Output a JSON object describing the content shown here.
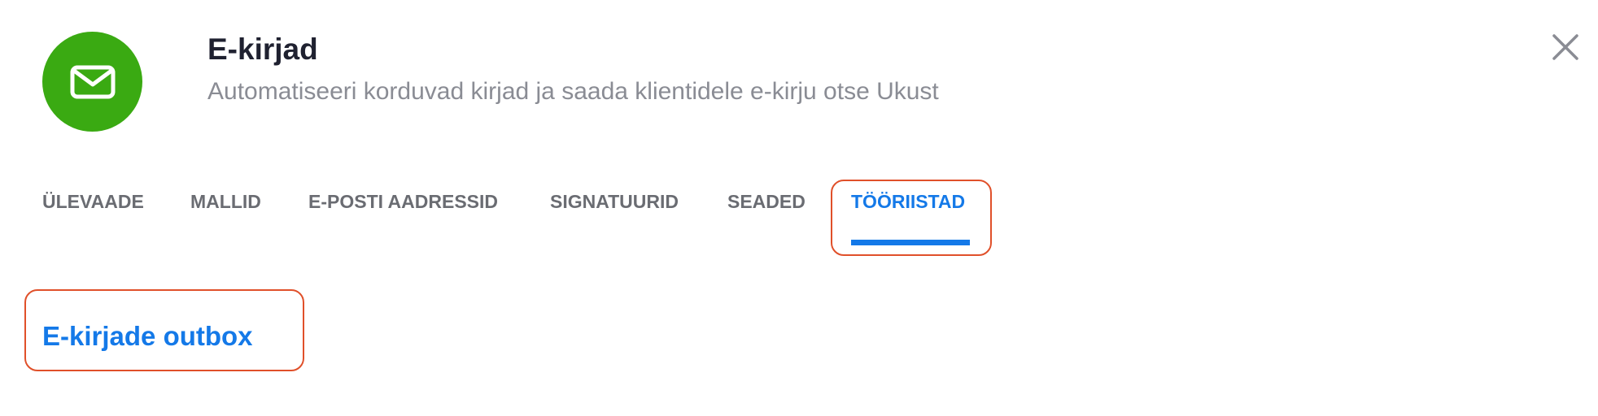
{
  "header": {
    "app_icon": "envelope-icon",
    "title": "E-kirjad",
    "subtitle": "Automatiseeri korduvad kirjad ja saada klientidele e-kirju otse Ukust",
    "close_icon": "close-icon"
  },
  "tabs": [
    {
      "label": "ÜLEVAADE",
      "active": false
    },
    {
      "label": "MALLID",
      "active": false
    },
    {
      "label": "E-POSTI AADRESSID",
      "active": false
    },
    {
      "label": "SIGNATUURID",
      "active": false
    },
    {
      "label": "SEADED",
      "active": false
    },
    {
      "label": "TÖÖRIISTAD",
      "active": true
    }
  ],
  "content": {
    "link_label": "E-kirjade outbox"
  },
  "colors": {
    "icon_bg": "#3aaa12",
    "accent": "#1479e8",
    "highlight": "#e0502a",
    "tab_inactive": "#6a6c72",
    "subtitle": "#8a8c94"
  }
}
